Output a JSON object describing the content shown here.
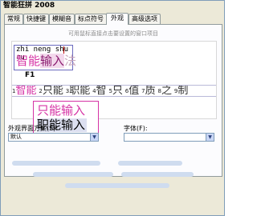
{
  "window": {
    "title": "智能狂拼 2008"
  },
  "tabs": [
    {
      "label": "常规",
      "active": false
    },
    {
      "label": "快捷键",
      "active": false
    },
    {
      "label": "模糊音",
      "active": false
    },
    {
      "label": "标点符号",
      "active": false
    },
    {
      "label": "外观",
      "active": true
    },
    {
      "label": "高级选项",
      "active": false
    }
  ],
  "preview": {
    "hint": "可用鼠标直接点击要设置的窗口项目",
    "composition": {
      "pinyin": "zhi neng shu ru",
      "text_part1": "智能",
      "text_part2": "输入",
      "text_part3": "法",
      "hotkey": "F1"
    },
    "candidates": [
      {
        "index": "1",
        "text": "智能"
      },
      {
        "index": "2",
        "text": "只能"
      },
      {
        "index": "3",
        "text": "职能"
      },
      {
        "index": "4",
        "text": "智"
      },
      {
        "index": "5",
        "text": "只"
      },
      {
        "index": "6",
        "text": "值"
      },
      {
        "index": "7",
        "text": "质"
      },
      {
        "index": "8",
        "text": "之"
      },
      {
        "index": "9",
        "text": "制"
      }
    ],
    "box2": {
      "line1": "只能输入",
      "line2": "职能输入"
    }
  },
  "scheme": {
    "label": "外观界面方案(S):",
    "value": "默认"
  },
  "font": {
    "label": "字体(F):",
    "value": ""
  },
  "colors": {
    "accent": "#d633a5",
    "tab_border": "#919b9c",
    "window_bg": "#ece9d8"
  }
}
